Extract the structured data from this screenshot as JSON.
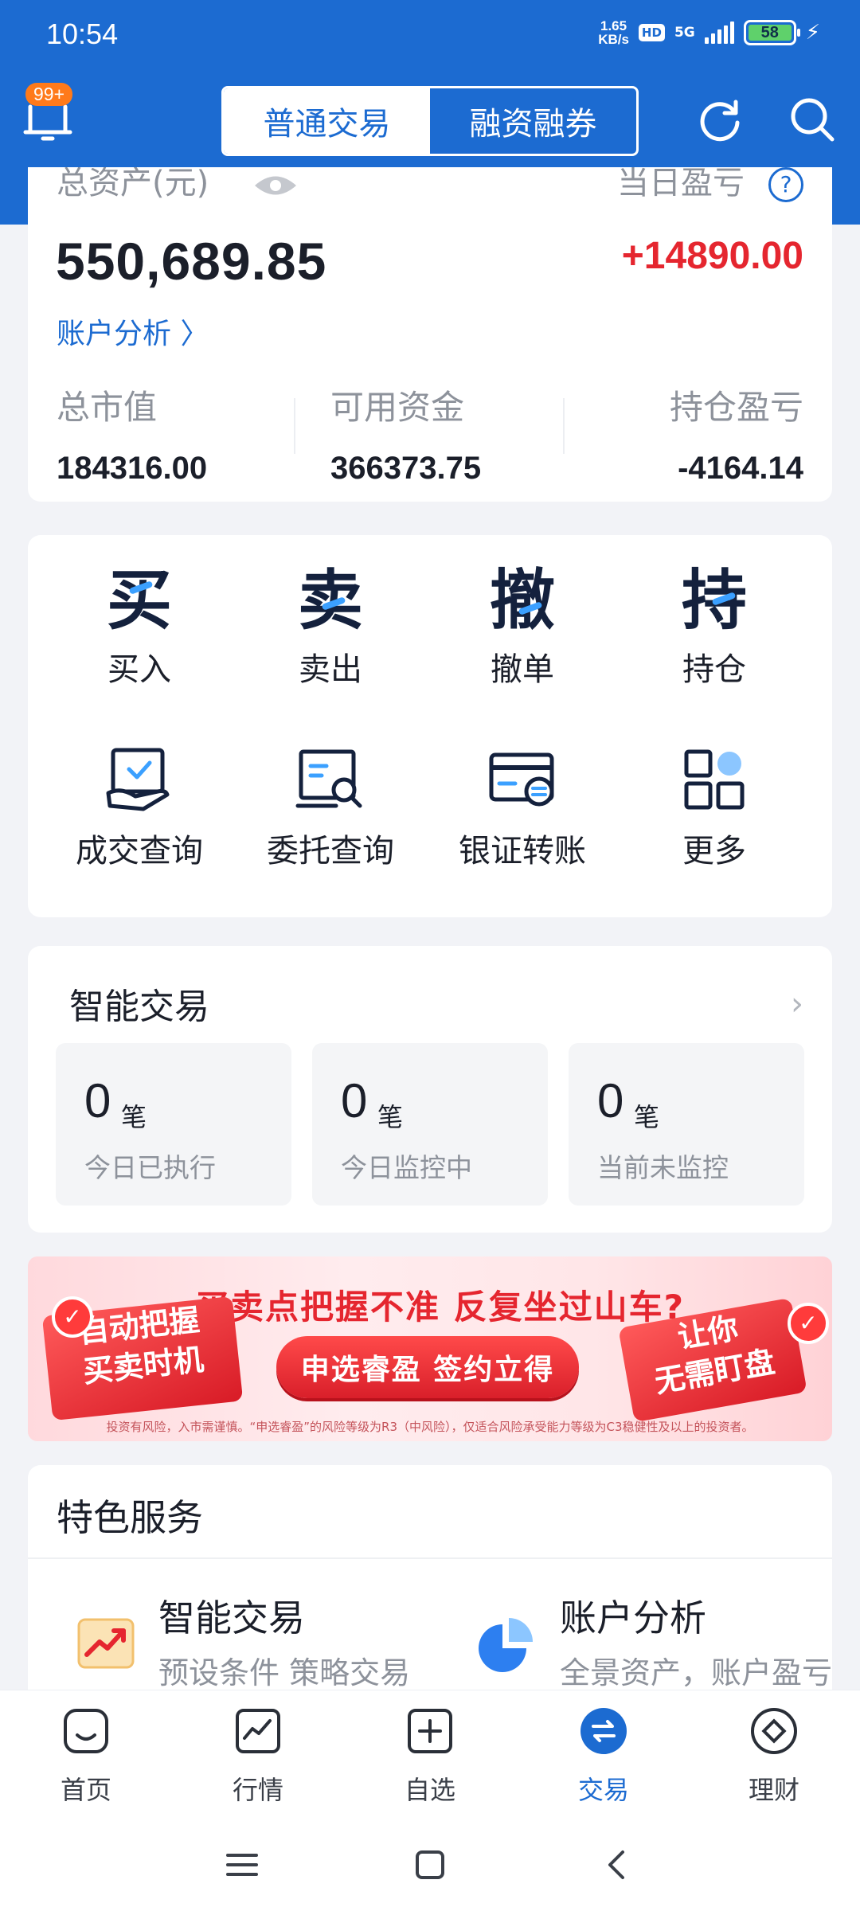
{
  "status_bar": {
    "time": "10:54",
    "speed_value": "1.65",
    "speed_unit": "KB/s",
    "hd": "HD",
    "network": "5G",
    "battery": "58",
    "charging_icon": "bolt-icon"
  },
  "header": {
    "notification_badge": "99+",
    "tabs": [
      {
        "label": "普通交易",
        "active": true
      },
      {
        "label": "融资融券",
        "active": false
      }
    ],
    "icons": [
      "refresh-icon",
      "search-icon"
    ],
    "accent_color": "#1c6bd1"
  },
  "assets": {
    "total_label": "总资产(元)",
    "total_value": "550,689.85",
    "today_label": "当日盈亏",
    "help_glyph": "?",
    "today_value": "+14890.00",
    "today_color": "#e5262f",
    "analysis_link": "账户分析 〉",
    "stats": [
      {
        "label": "总市值",
        "value": "184316.00"
      },
      {
        "label": "可用资金",
        "value": "366373.75"
      },
      {
        "label": "持仓盈亏",
        "value": "-4164.14"
      }
    ]
  },
  "actions": {
    "primary": [
      {
        "char": "买",
        "label": "买入"
      },
      {
        "char": "卖",
        "label": "卖出"
      },
      {
        "char": "撤",
        "label": "撤单"
      },
      {
        "char": "持",
        "label": "持仓"
      }
    ],
    "secondary": [
      {
        "icon": "deal-query-icon",
        "label": "成交查询"
      },
      {
        "icon": "order-query-icon",
        "label": "委托查询"
      },
      {
        "icon": "bank-transfer-icon",
        "label": "银证转账"
      },
      {
        "icon": "more-grid-icon",
        "label": "更多"
      }
    ]
  },
  "smart_trade": {
    "title": "智能交易",
    "chevron": "›",
    "boxes": [
      {
        "count": "0",
        "unit": "笔",
        "desc": "今日已执行"
      },
      {
        "count": "0",
        "unit": "笔",
        "desc": "今日监控中"
      },
      {
        "count": "0",
        "unit": "笔",
        "desc": "当前未监控"
      }
    ]
  },
  "banner": {
    "headline": "买卖点把握不准 反复坐过山车?",
    "button": "申选睿盈 签约立得",
    "left_tag_line1": "自动把握",
    "left_tag_line2": "买卖时机",
    "right_tag_line1": "让你",
    "right_tag_line2": "无需盯盘",
    "check": "✓",
    "disclaimer": "投资有风险，入市需谨慎。“申选睿盈”的风险等级为R3（中风险），仅适合风险承受能力等级为C3稳健性及以上的投资者。"
  },
  "services": {
    "title": "特色服务",
    "items": [
      {
        "icon": "chart-trend-icon",
        "title": "智能交易",
        "desc": "预设条件 策略交易"
      },
      {
        "icon": "pie-chart-icon",
        "title": "账户分析",
        "desc": "全景资产，账户盈亏"
      }
    ]
  },
  "bottom_nav": [
    {
      "icon": "home-icon",
      "label": "首页",
      "active": false
    },
    {
      "icon": "market-icon",
      "label": "行情",
      "active": false
    },
    {
      "icon": "watchlist-icon",
      "label": "自选",
      "active": false
    },
    {
      "icon": "trade-icon",
      "label": "交易",
      "active": true
    },
    {
      "icon": "wealth-icon",
      "label": "理财",
      "active": false
    }
  ]
}
